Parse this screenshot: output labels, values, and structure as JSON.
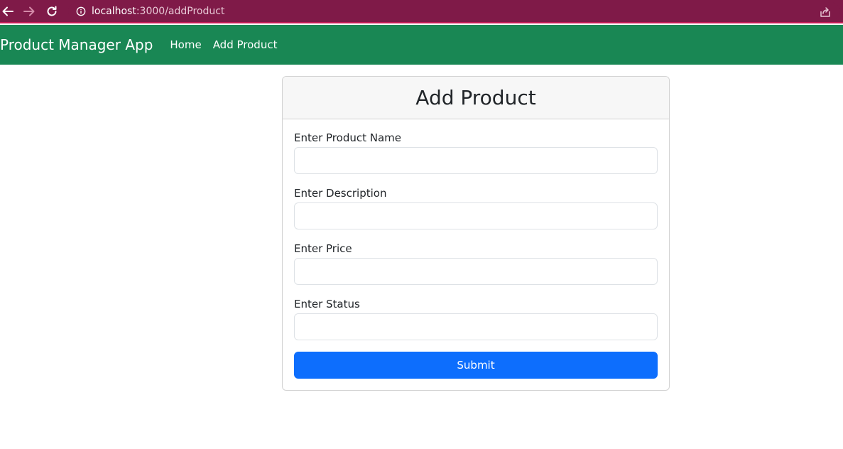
{
  "browser": {
    "url_host": "localhost",
    "url_rest": ":3000/addProduct"
  },
  "navbar": {
    "brand": "Product Manager App",
    "links": [
      "Home",
      "Add Product"
    ]
  },
  "form": {
    "title": "Add Product",
    "fields": [
      {
        "label": "Enter Product Name",
        "value": ""
      },
      {
        "label": "Enter Description",
        "value": ""
      },
      {
        "label": "Enter Price",
        "value": ""
      },
      {
        "label": "Enter Status",
        "value": ""
      }
    ],
    "submit_label": "Submit"
  },
  "colors": {
    "browser_bar": "#7f1a48",
    "navbar": "#198754",
    "primary_button": "#0d6efd"
  }
}
